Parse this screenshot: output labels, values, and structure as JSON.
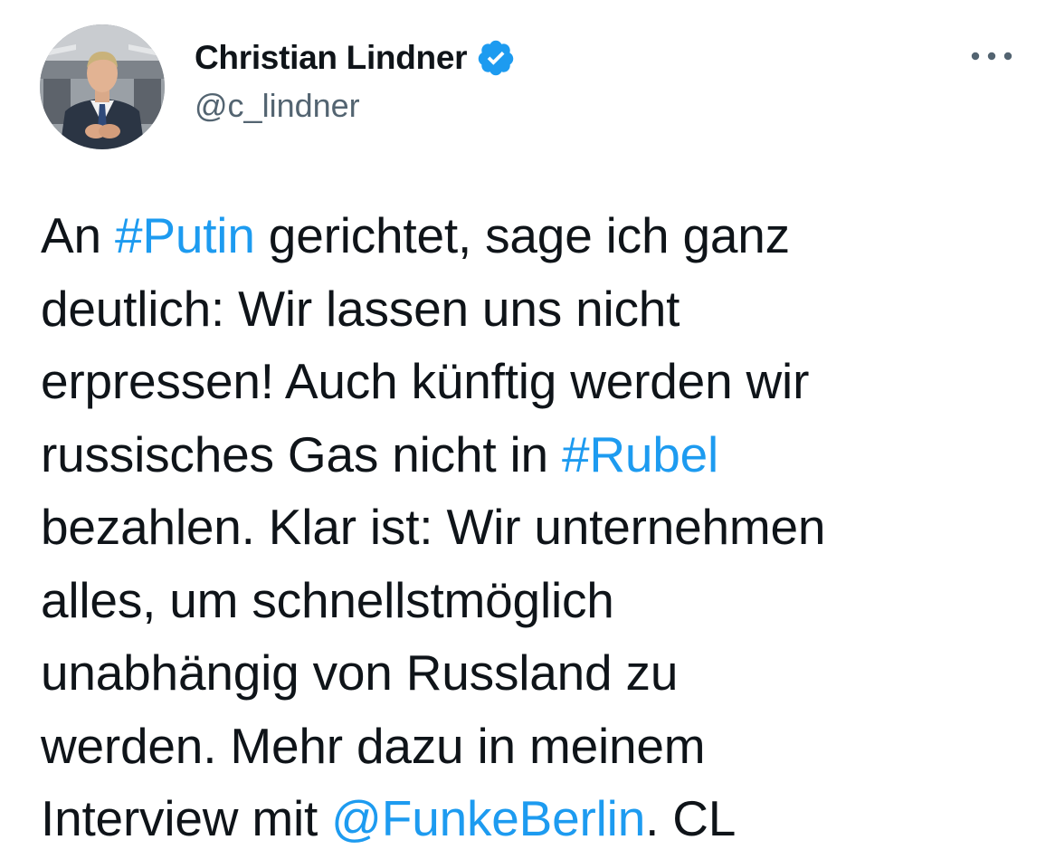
{
  "author": {
    "display_name": "Christian Lindner",
    "handle": "@c_lindner",
    "verified": true,
    "avatar_icon": "profile-photo"
  },
  "menu": {
    "more_icon": "more-horizontal-icon"
  },
  "colors": {
    "link": "#1d9bf0",
    "text": "#0f1419",
    "secondary_text": "#536471",
    "verified_badge": "#1d9bf0"
  },
  "tweet": {
    "lines": [
      {
        "parts": [
          {
            "text": "An ",
            "type": "text"
          },
          {
            "text": "#Putin",
            "type": "hashtag"
          },
          {
            "text": " gerichtet, sage ich ganz",
            "type": "text"
          }
        ]
      },
      {
        "parts": [
          {
            "text": "deutlich: Wir lassen uns nicht",
            "type": "text"
          }
        ]
      },
      {
        "parts": [
          {
            "text": "erpressen! Auch künftig werden wir",
            "type": "text"
          }
        ]
      },
      {
        "parts": [
          {
            "text": "russisches Gas nicht in ",
            "type": "text"
          },
          {
            "text": "#Rubel",
            "type": "hashtag"
          }
        ]
      },
      {
        "parts": [
          {
            "text": "bezahlen. Klar ist: Wir unternehmen",
            "type": "text"
          }
        ]
      },
      {
        "parts": [
          {
            "text": "alles, um schnellstmöglich",
            "type": "text"
          }
        ]
      },
      {
        "parts": [
          {
            "text": "unabhängig von Russland zu",
            "type": "text"
          }
        ]
      },
      {
        "parts": [
          {
            "text": "werden. Mehr dazu in meinem",
            "type": "text"
          }
        ]
      },
      {
        "parts": [
          {
            "text": "Interview mit ",
            "type": "text"
          },
          {
            "text": "@FunkeBerlin",
            "type": "mention"
          },
          {
            "text": ". CL",
            "type": "text"
          }
        ]
      }
    ]
  }
}
